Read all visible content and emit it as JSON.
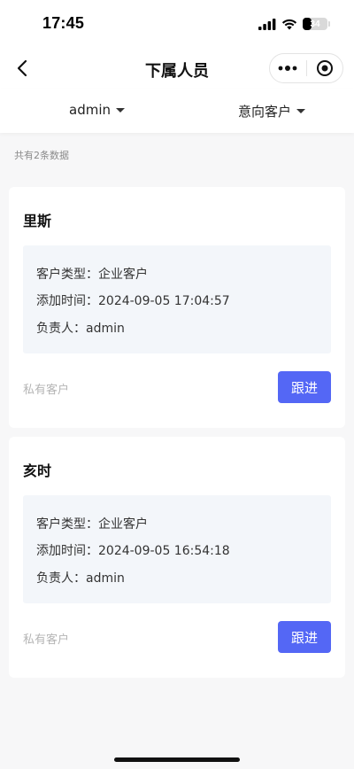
{
  "status_bar": {
    "time": "17:45",
    "battery_level": "34",
    "icons": [
      "signal-icon",
      "wifi-icon",
      "battery-icon"
    ]
  },
  "nav": {
    "title": "下属人员",
    "back_icon": "chevron-left-icon",
    "more_icon": "more-dots-icon",
    "close_icon": "target-circle-icon"
  },
  "filters": {
    "user": "admin",
    "customer_type": "意向客户"
  },
  "list": {
    "count_text": "共有2条数据",
    "items": [
      {
        "name": "里斯",
        "type_line": "客户类型：企业客户",
        "time_line": "添加时间：2024-09-05 17:04:57",
        "owner_line": "负责人：admin",
        "tag": "私有客户",
        "action_label": "跟进"
      },
      {
        "name": "亥时",
        "type_line": "客户类型：企业客户",
        "time_line": "添加时间：2024-09-05 16:54:18",
        "owner_line": "负责人：admin",
        "tag": "私有客户",
        "action_label": "跟进"
      }
    ]
  },
  "colors": {
    "accent": "#5467f5",
    "background": "#f7f7f8",
    "info_box": "#f3f6fa"
  }
}
